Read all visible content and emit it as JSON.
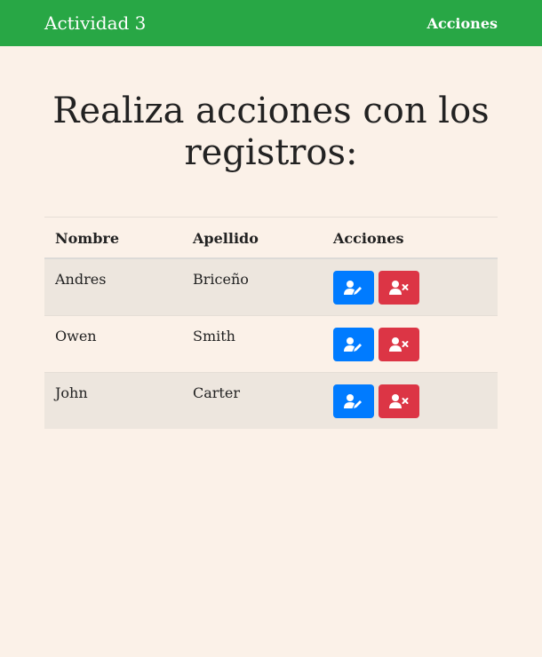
{
  "navbar": {
    "brand": "Actividad 3",
    "link": "Acciones"
  },
  "page": {
    "title": "Realiza acciones con los registros:"
  },
  "table": {
    "headers": [
      "Nombre",
      "Apellido",
      "Acciones"
    ],
    "rows": [
      {
        "nombre": "Andres",
        "apellido": "Briceño"
      },
      {
        "nombre": "Owen",
        "apellido": "Smith"
      },
      {
        "nombre": "John",
        "apellido": "Carter"
      }
    ]
  },
  "icons": {
    "edit": "user-edit-icon",
    "delete": "user-times-icon"
  },
  "colors": {
    "navbar": "#28a745",
    "background": "#fbf1e8",
    "edit_button": "#007bff",
    "delete_button": "#dc3545",
    "striped_row": "#ede6de"
  }
}
